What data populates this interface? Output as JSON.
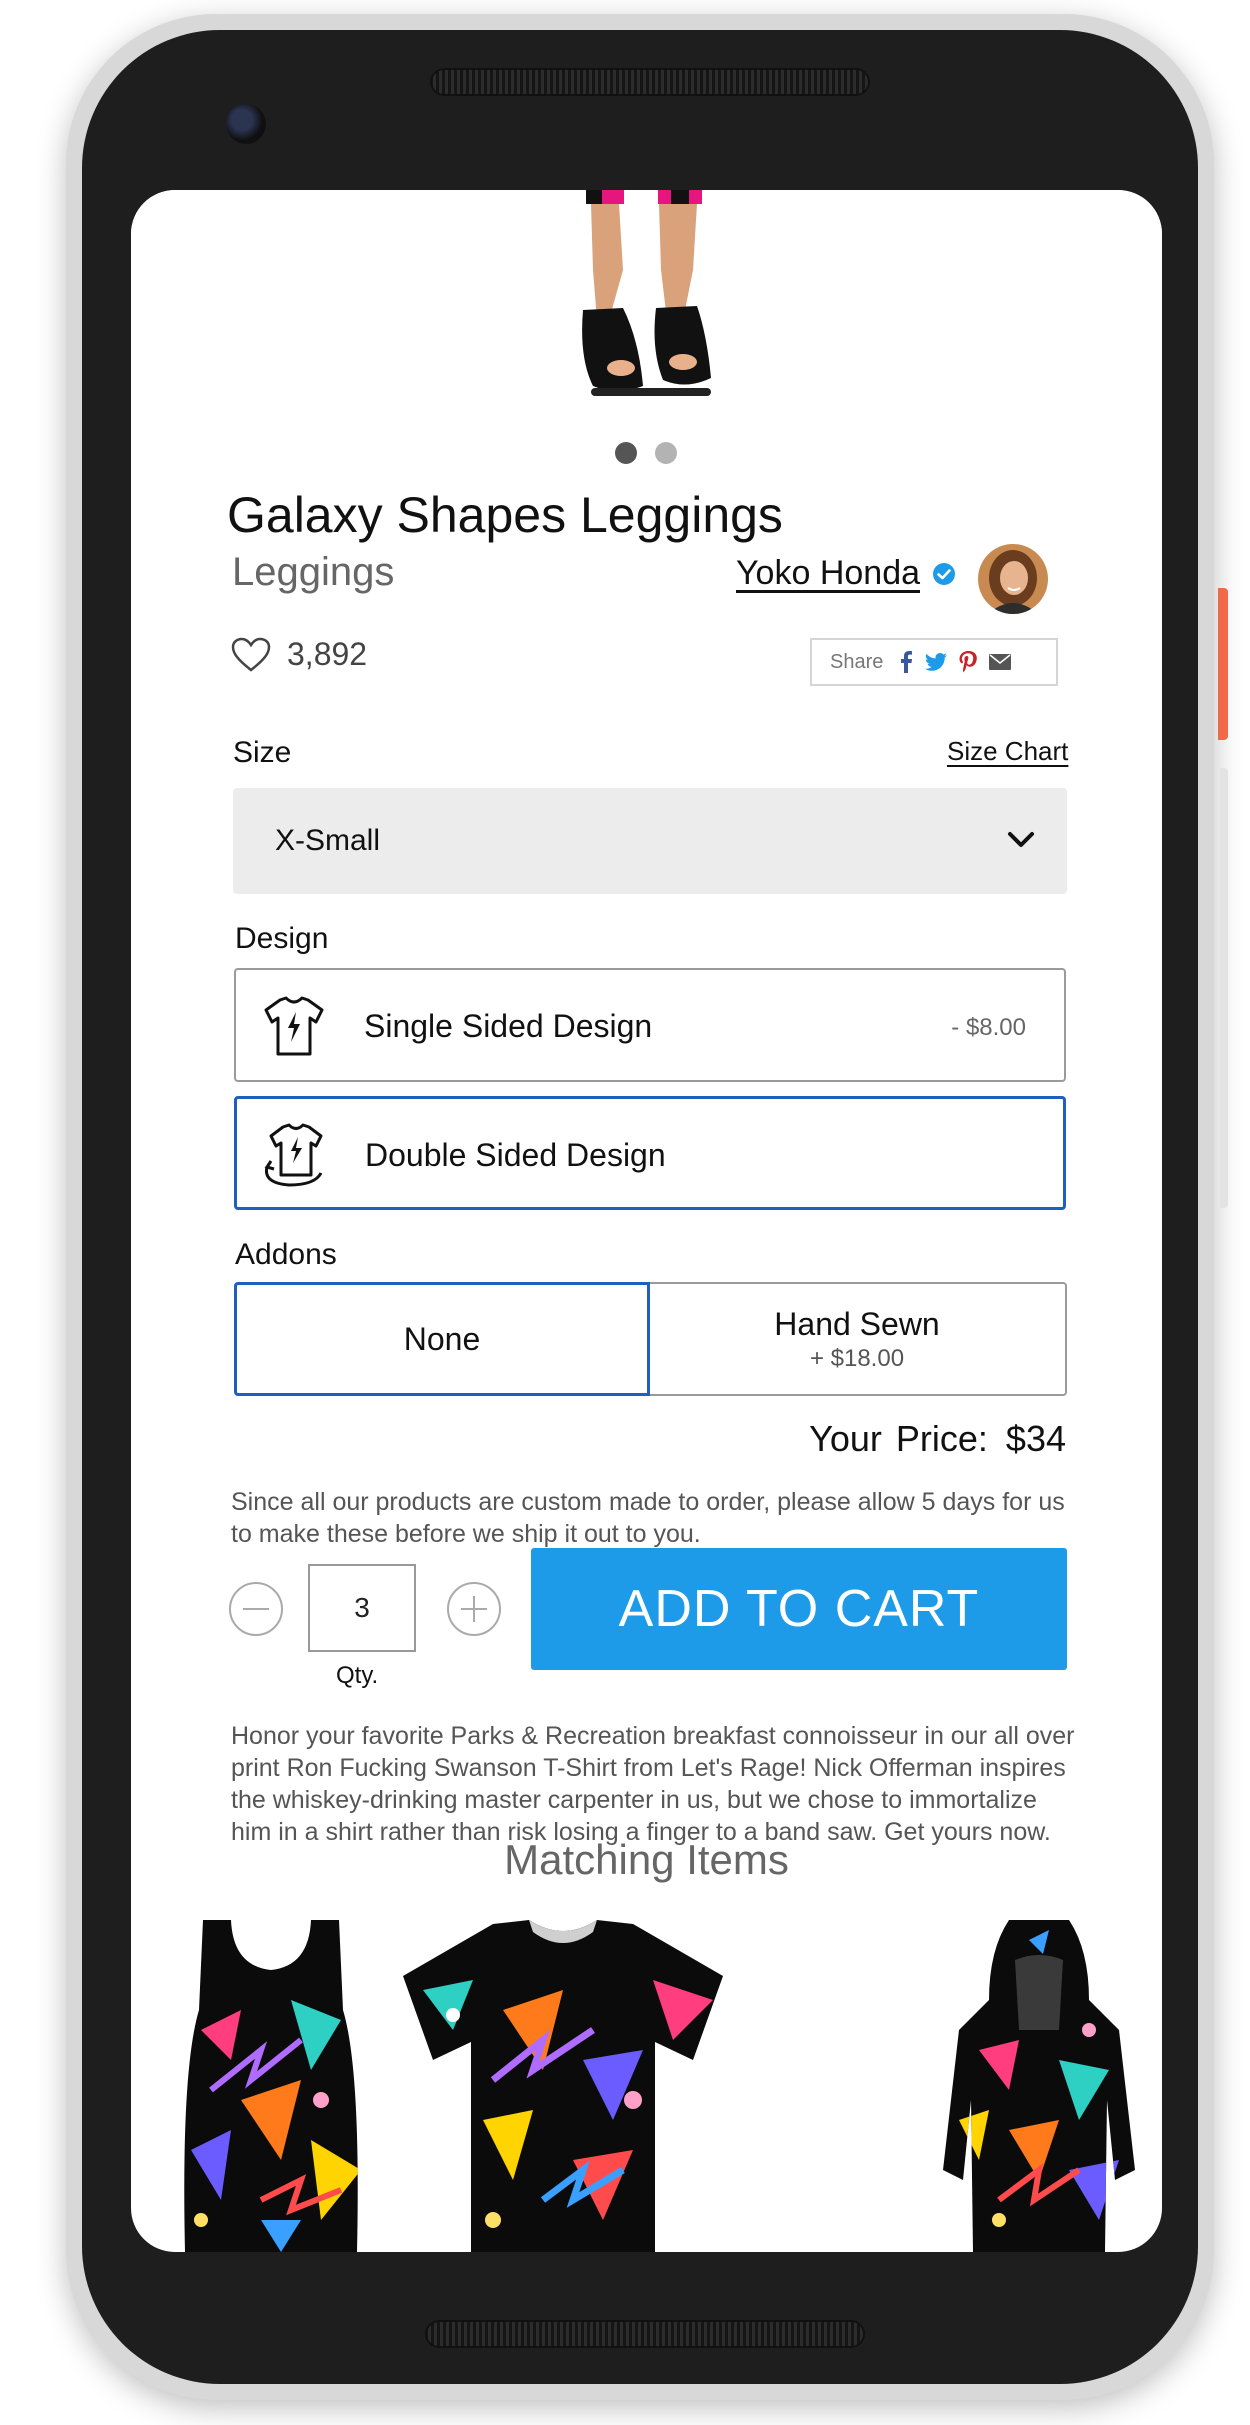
{
  "carousel": {
    "total": 2,
    "active_index": 0
  },
  "product": {
    "title": "Galaxy Shapes Leggings",
    "category": "Leggings",
    "seller_name": "Yoko Honda",
    "likes": "3,892"
  },
  "share": {
    "label": "Share",
    "icons": [
      "facebook-icon",
      "twitter-icon",
      "pinterest-icon",
      "email-icon"
    ]
  },
  "size": {
    "label": "Size",
    "chart_link": "Size Chart",
    "selected": "X-Small"
  },
  "design": {
    "label": "Design",
    "options": [
      {
        "label": "Single Sided Design",
        "price": "- $8.00",
        "selected": false
      },
      {
        "label": "Double Sided Design",
        "price": "",
        "selected": true
      }
    ]
  },
  "addons": {
    "label": "Addons",
    "options": [
      {
        "label": "None",
        "price": "",
        "selected": true
      },
      {
        "label": "Hand Sewn",
        "price": "+ $18.00",
        "selected": false
      }
    ]
  },
  "price": {
    "label": "Your Price:",
    "value": "$34"
  },
  "notice": "Since all our products are custom made to order, please allow 5 days for us to make these before we ship it out to you.",
  "quantity": {
    "value": "3",
    "label": "Qty."
  },
  "cart": {
    "button": "ADD TO CART"
  },
  "description": "Honor your favorite Parks & Recreation breakfast connoisseur in our all over print Ron Fucking Swanson T-Shirt from Let's Rage! Nick Offerman inspires the whiskey-drinking master carpenter in us, but we chose to immortalize him in a shirt rather than risk losing a finger to a band saw. Get yours now.",
  "matching": {
    "title": "Matching Items"
  },
  "colors": {
    "accent_blue": "#1d9be8",
    "selected_border": "#1f5fbf",
    "side_button": "#f06a4a"
  }
}
